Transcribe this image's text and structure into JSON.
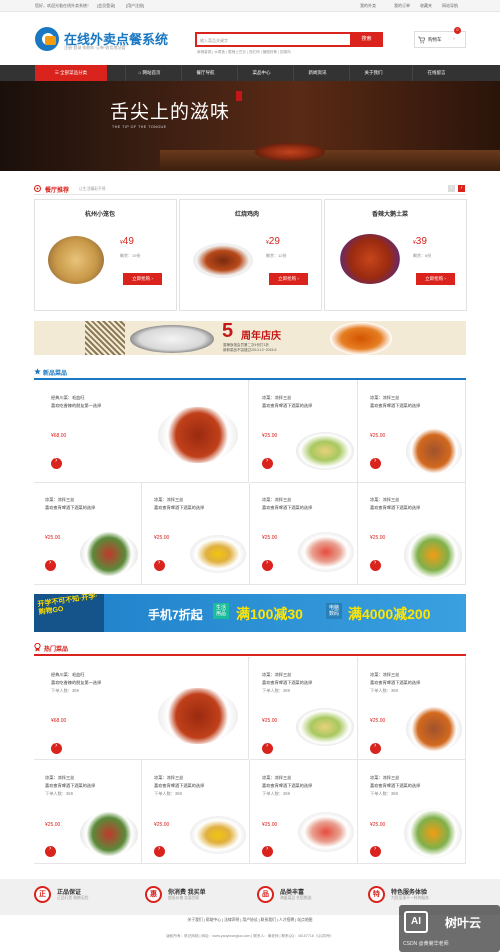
{
  "topbar": {
    "greeting": "您好，欢迎光临在线外卖系统！",
    "login": "[会员登录]",
    "register": "[用户注册]",
    "links": [
      "我的外卖",
      "我的订单",
      "收藏夹",
      "网站导航"
    ]
  },
  "header": {
    "title": "在线外卖点餐系统",
    "subtitle": "注册·登录·购物车·订单·收货地址管",
    "search_placeholder": "输入菜品关键字",
    "search_button": "搜索",
    "hot_words": "麻辣香锅 | 水煮鱼 | 酸辣土豆丝 | 西红柿 | 糖醋排骨 | 回锅肉",
    "cart_label": "购物车",
    "cart_count": "0"
  },
  "nav": {
    "category": "全部菜品分类",
    "items": [
      "网站首页",
      "餐厅导航",
      "菜品中心",
      "新闻资讯",
      "关于我们",
      "在线留言"
    ]
  },
  "banner": {
    "title": "舌尖上的滋味",
    "subtitle": "THE TIP OF THE TONGUE"
  },
  "recommend": {
    "title": "餐厅推荐",
    "note": "让生活精彩不停",
    "cards": [
      {
        "name": "杭州小笼包",
        "price": "49",
        "left": "剩余：19份",
        "button": "立即抢购 ›"
      },
      {
        "name": "红烧鸡肉",
        "price": "29",
        "left": "剩余：12份",
        "button": "立即抢购 ›"
      },
      {
        "name": "香辣大鹅土菜",
        "price": "39",
        "left": "剩余：6份",
        "button": "立即抢购 ›"
      }
    ]
  },
  "promo": {
    "five": "5",
    "title": "周年店庆",
    "line1": "香辣饭馆会员第二次4份打1折",
    "line2": "新鲜菜品不容错过2013.12~2015.6"
  },
  "new_dishes": {
    "title": "新品菜品",
    "big": {
      "name": "经典川菜：毛血旺",
      "desc": "喜欢吃香辣的朋友第一选择",
      "price": "¥68.00"
    },
    "small": {
      "name": "凉菜：凉拌三丝",
      "desc": "喜欢夜宵啤酒下酒菜的选择",
      "price": "¥25.00"
    }
  },
  "promo2": {
    "left": "开学不可不知·开学·购物GO",
    "phone": "手机7折起",
    "box1": "生活用品",
    "deal1": "满100减30",
    "box2": "电脑数码",
    "deal2": "满4000减200"
  },
  "hot_dishes": {
    "title": "热门菜品",
    "big": {
      "name": "经典川菜：毛血旺",
      "desc": "喜欢吃香辣的朋友第一选择",
      "count": "下单人数：369",
      "price": "¥68.00"
    },
    "small": {
      "name": "凉菜：凉拌三丝",
      "desc": "喜欢夜宵啤酒下酒菜的选择",
      "count": "下单人数：369",
      "price": "¥25.00"
    }
  },
  "footer": {
    "features": [
      {
        "icon": "正",
        "title": "正品保证",
        "sub": "正品行货 购物无忧"
      },
      {
        "icon": "惠",
        "title": "你消费 我买单",
        "sub": "超低价格 实惠到家"
      },
      {
        "icon": "品",
        "title": "品类丰富",
        "sub": "海量菜品 任您挑选"
      },
      {
        "icon": "特",
        "title": "特色服务体验",
        "sub": "为您呈现不一样的服务"
      }
    ],
    "links": "关于我们 | 帮助中心 | 法律声明 | 用户协议 | 联系我们 | 人才招聘 | 站点地图",
    "copyright": "版权所有：陈记网络 | 网址：www.yaoyiwangluo.com | 联系人：黄老师 | 联系QQ：45157718（QQ同号）"
  },
  "watermark": {
    "logo": "AI",
    "name": "树叶云",
    "csdn": "CSDN @黄菊华老师"
  },
  "colors": {
    "accent": "#d9231c",
    "brand": "#1a78c2",
    "nav": "#333333"
  }
}
